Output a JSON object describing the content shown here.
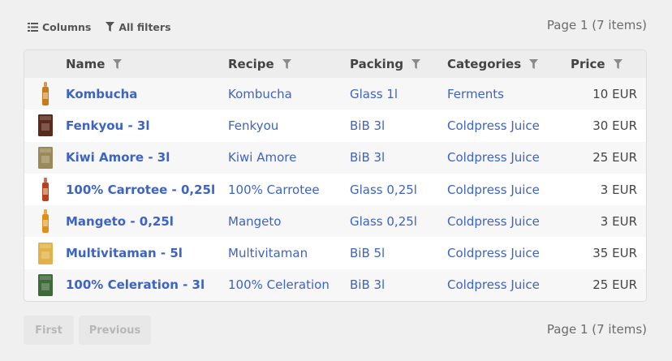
{
  "toolbar": {
    "columns_label": "Columns",
    "filters_label": "All filters",
    "page_info": "Page 1 (7 items)"
  },
  "table": {
    "headers": {
      "name": "Name",
      "recipe": "Recipe",
      "packing": "Packing",
      "categories": "Categories",
      "price": "Price"
    },
    "rows": [
      {
        "name": "Kombucha",
        "recipe": "Kombucha",
        "packing": "Glass 1l",
        "category": "Ferments",
        "price": "10 EUR",
        "thumb_color": "#c97a1c",
        "thumb_shape": "bottle"
      },
      {
        "name": "Fenkyou - 3l",
        "recipe": "Fenkyou",
        "packing": "BiB 3l",
        "category": "Coldpress Juice",
        "price": "30 EUR",
        "thumb_color": "#5a2a1c",
        "thumb_shape": "bag"
      },
      {
        "name": "Kiwi Amore - 3l",
        "recipe": "Kiwi Amore",
        "packing": "BiB 3l",
        "category": "Coldpress Juice",
        "price": "25 EUR",
        "thumb_color": "#9a8a5a",
        "thumb_shape": "bag"
      },
      {
        "name": "100% Carrotee - 0,25l",
        "recipe": "100% Carrotee",
        "packing": "Glass 0,25l",
        "category": "Coldpress Juice",
        "price": "3 EUR",
        "thumb_color": "#b8401c",
        "thumb_shape": "bottle"
      },
      {
        "name": "Mangeto - 0,25l",
        "recipe": "Mangeto",
        "packing": "Glass 0,25l",
        "category": "Coldpress Juice",
        "price": "3 EUR",
        "thumb_color": "#e0901a",
        "thumb_shape": "bottle"
      },
      {
        "name": "Multivitaman - 5l",
        "recipe": "Multivitaman",
        "packing": "BiB 5l",
        "category": "Coldpress Juice",
        "price": "35 EUR",
        "thumb_color": "#e2b24a",
        "thumb_shape": "bag"
      },
      {
        "name": "100% Celeration - 3l",
        "recipe": "100% Celeration",
        "packing": "BiB 3l",
        "category": "Coldpress Juice",
        "price": "25 EUR",
        "thumb_color": "#3e6a3a",
        "thumb_shape": "bag"
      }
    ]
  },
  "pagination": {
    "first_label": "First",
    "previous_label": "Previous",
    "page_info": "Page 1 (7 items)"
  },
  "colors": {
    "link": "#3d63c6",
    "header_bg": "#ededed",
    "background": "#f0f0f0"
  },
  "icons": {
    "columns": "columns-icon",
    "filter": "funnel-icon"
  }
}
